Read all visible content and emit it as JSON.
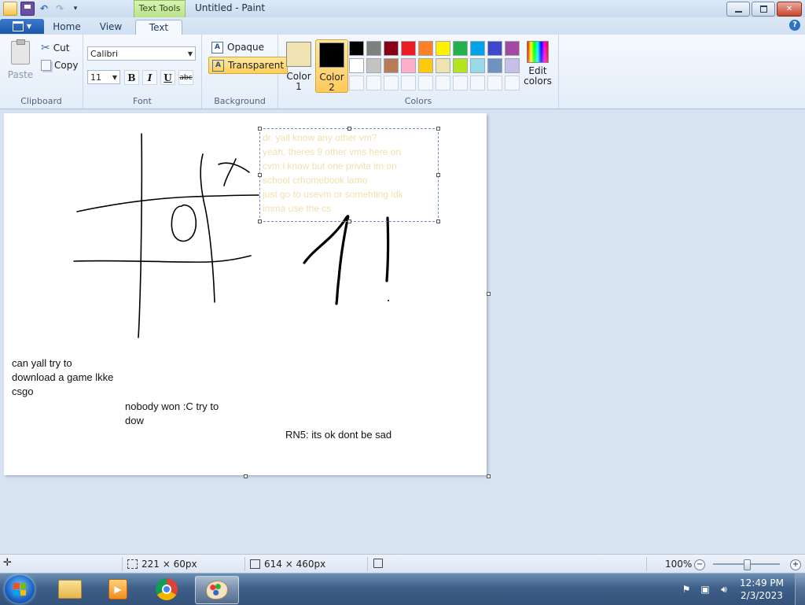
{
  "window": {
    "context_tab": "Text Tools",
    "title": "Untitled - Paint"
  },
  "tabs": {
    "home": "Home",
    "view": "View",
    "text": "Text"
  },
  "clipboard": {
    "paste": "Paste",
    "cut": "Cut",
    "copy": "Copy",
    "label": "Clipboard"
  },
  "font": {
    "family": "Calibri",
    "size": "11",
    "bold": "B",
    "italic": "I",
    "underline": "U",
    "strike": "abc",
    "label": "Font"
  },
  "background": {
    "opaque": "Opaque",
    "transparent": "Transparent",
    "label": "Background"
  },
  "colors": {
    "color1_label_a": "Color",
    "color1_label_b": "1",
    "color2_label_a": "Color",
    "color2_label_b": "2",
    "color1": "#f0e3b2",
    "color2": "#000000",
    "palette": [
      "#000000",
      "#7f7f7f",
      "#880015",
      "#ed1c24",
      "#ff7f27",
      "#fff200",
      "#22b14c",
      "#00a2e8",
      "#3f48cc",
      "#a349a4",
      "#ffffff",
      "#c3c3c3",
      "#b97a57",
      "#ffaec9",
      "#ffc90e",
      "#efe4b0",
      "#b5e61d",
      "#99d9ea",
      "#7092be",
      "#c8bfe7"
    ],
    "edit_a": "Edit",
    "edit_b": "colors",
    "label": "Colors"
  },
  "canvas": {
    "text_1_line1": "can yall try to",
    "text_1_line2": "download a game lkke",
    "text_1_line3": "csgo",
    "text_2_line1": "nobody won :C try to",
    "text_2_line2": "dow",
    "text_3": "RN5: its ok dont be sad",
    "selection_lines": [
      "dr. yall know any other vm?",
      "yeah, theres 9 other vms here on",
      "cvm i know but one privite im on",
      "school crhomebook lamo",
      "just go to usevm or somehting idk",
      "imma use the cs"
    ]
  },
  "status": {
    "selection_size": "221 × 60px",
    "canvas_size": "614 × 460px",
    "zoom": "100%"
  },
  "clock": {
    "time": "12:49 PM",
    "date": "2/3/2023"
  }
}
